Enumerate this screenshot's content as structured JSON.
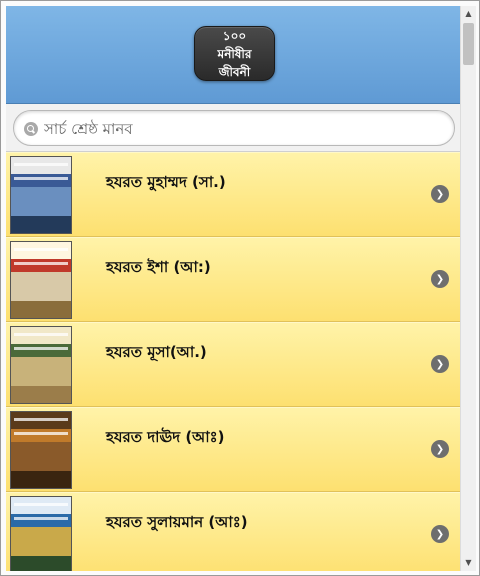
{
  "header": {
    "title": "১০০ মনীষীর\nজীবনী"
  },
  "search": {
    "placeholder": "সার্চ শ্রেষ্ঠ মানব",
    "value": ""
  },
  "items": [
    {
      "title": "হযরত মুহাম্মদ (সা.)",
      "colors": [
        "#e8e8e8",
        "#3a5a96",
        "#6a8fbf",
        "#233a5a"
      ]
    },
    {
      "title": "হযরত ইশা (আ:)",
      "colors": [
        "#fff6e0",
        "#c0392b",
        "#d8c9a8",
        "#8a6d3b"
      ]
    },
    {
      "title": "হযরত মূসা(আ.)",
      "colors": [
        "#f1e8c8",
        "#4a6a3a",
        "#c8b27a",
        "#9b7d4a"
      ]
    },
    {
      "title": "হযরত দাঊদ (আঃ)",
      "colors": [
        "#5a3a1a",
        "#c07a2a",
        "#8a5a2a",
        "#3a2510"
      ]
    },
    {
      "title": "হযরত সুলায়মান (আঃ)",
      "colors": [
        "#dfeaf5",
        "#2a6aa8",
        "#c9a94a",
        "#2c4b2a"
      ]
    }
  ],
  "icons": {
    "search": "search-icon",
    "chevron": "chevron-right-icon"
  }
}
